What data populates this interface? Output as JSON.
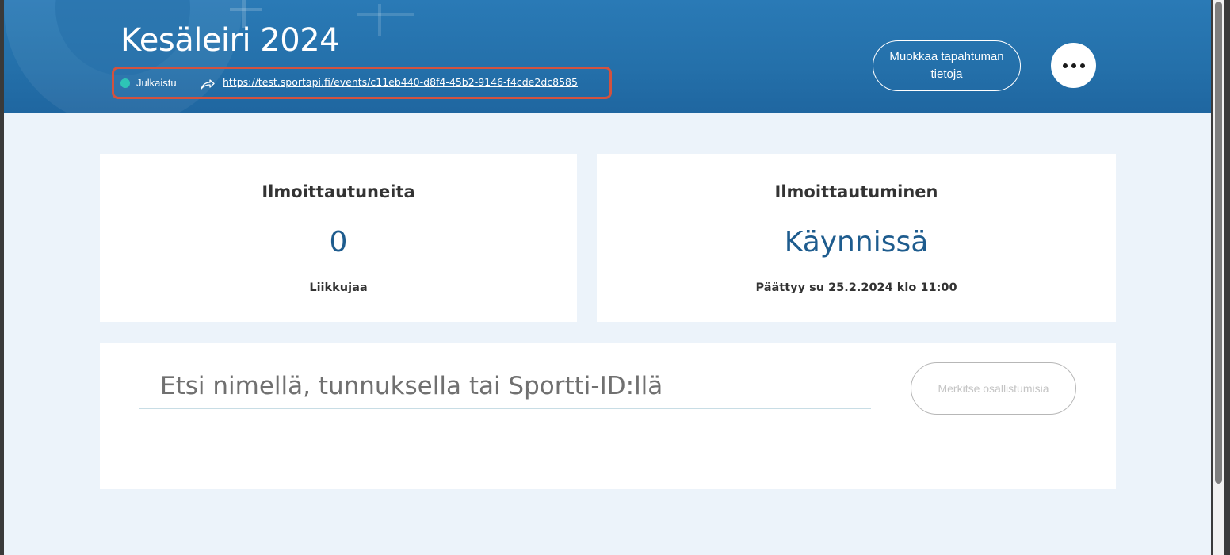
{
  "header": {
    "title": "Kesäleiri 2024",
    "status": "Julkaistu",
    "event_url": "https://test.sportapi.fi/events/c11eb440-d8f4-45b2-9146-f4cde2dc8585",
    "edit_button_label": "Muokkaa tapahtuman tietoja",
    "more_icon": "more-horizontal-icon",
    "share_icon": "share-arrow-icon",
    "status_color": "#2ec4b6"
  },
  "stats": {
    "registrations": {
      "title": "Ilmoittautuneita",
      "value": "0",
      "unit": "Liikkujaa"
    },
    "registration_status": {
      "title": "Ilmoittautuminen",
      "value": "Käynnissä",
      "ends": "Päättyy su 25.2.2024 klo 11:00"
    }
  },
  "participants": {
    "search_placeholder": "Etsi nimellä, tunnuksella tai Sportti-ID:llä",
    "search_value": "",
    "mark_button_label": "Merkitse osallistumisia"
  },
  "colors": {
    "header_bg": "#2470aa",
    "accent_value": "#1e5c8e",
    "highlight_border": "#d2523f"
  }
}
